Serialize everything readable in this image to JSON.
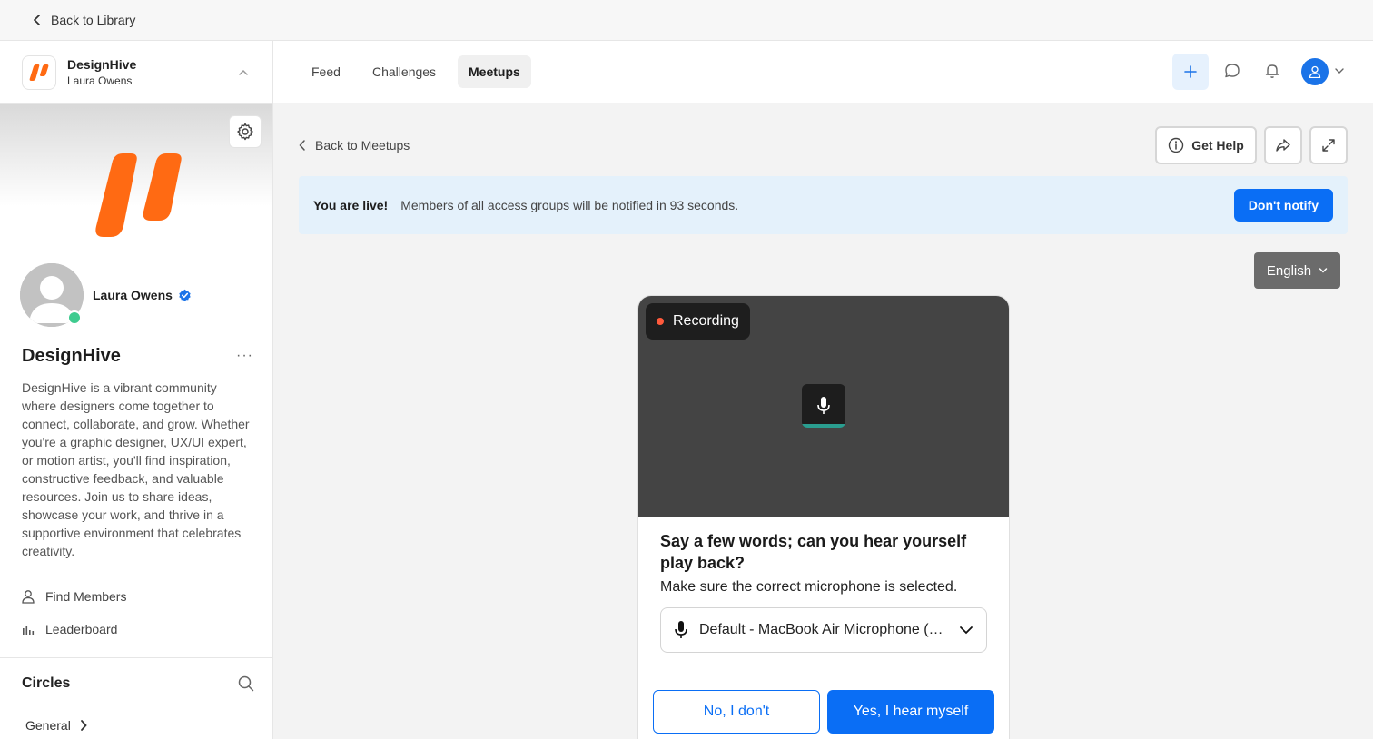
{
  "topbar": {
    "back_label": "Back to Library"
  },
  "community": {
    "name": "DesignHive",
    "user": "Laura Owens",
    "brand_color": "#ff6a13"
  },
  "profile": {
    "name": "Laura Owens",
    "status_color": "#3ecb8f",
    "verified_color": "#1a73e8"
  },
  "org": {
    "title": "DesignHive",
    "more_label": "···",
    "description": "DesignHive is a vibrant community where designers come together to connect, collaborate, and grow. Whether you're a graphic designer, UX/UI expert, or motion artist, you'll find inspiration, constructive feedback, and valuable resources. Join us to share ideas, showcase your work, and thrive in a supportive environment that celebrates creativity."
  },
  "sidebar_links": [
    {
      "label": "Find Members",
      "icon": "person-icon"
    },
    {
      "label": "Leaderboard",
      "icon": "bars-icon"
    }
  ],
  "circles": {
    "title": "Circles",
    "items": [
      {
        "label": "General"
      }
    ]
  },
  "tabs": [
    {
      "label": "Feed",
      "active": false
    },
    {
      "label": "Challenges",
      "active": false
    },
    {
      "label": "Meetups",
      "active": true
    }
  ],
  "header_icons": [
    "plus-icon",
    "chat-icon",
    "bell-icon",
    "user-icon",
    "chevron-down-icon"
  ],
  "content": {
    "back_label": "Back to Meetups",
    "get_help_label": "Get Help",
    "live_title": "You are live!",
    "live_message": "Members of all access groups will be notified in 93 seconds.",
    "dont_notify_label": "Don't notify",
    "language": "English",
    "accent_color": "#0a6ef5"
  },
  "modal": {
    "recording_label": "Recording",
    "title": "Say a few words; can you hear yourself play back?",
    "subtitle": "Make sure the correct microphone is selected.",
    "mic_value": "Default - MacBook Air Microphone (Built-in)",
    "no_label": "No, I don't",
    "yes_label": "Yes, I hear myself",
    "recording_dot_color": "#ff5a3c"
  }
}
